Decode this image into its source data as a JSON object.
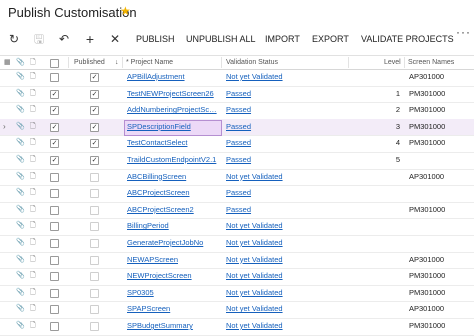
{
  "title": "Publish Customisation",
  "icons": {
    "favorite": "★",
    "refresh": "↻",
    "save": "🖫",
    "undo": "↶",
    "add": "+",
    "delete": "✕",
    "more": "⋮",
    "attachment": "📎",
    "notes": "🗋",
    "row_indicator": "›",
    "sort_arrow": "↓"
  },
  "toolbar": {
    "publish": "PUBLISH",
    "unpublish_all": "UNPUBLISH ALL",
    "import": "IMPORT",
    "export": "EXPORT",
    "validate_projects": "VALIDATE PROJECTS",
    "more": "···"
  },
  "columns": {
    "published": "Published",
    "project_name": "* Project Name",
    "validation_status": "Validation Status",
    "level": "Level",
    "screen_names": "Screen Names"
  },
  "rows": [
    {
      "checked": false,
      "published": true,
      "project": "APBillAdjustment",
      "status": "Not yet Validated",
      "level": "",
      "screens": "AP301000"
    },
    {
      "checked": true,
      "published": true,
      "project": "TestNEWProjectScreen26",
      "status": "Passed",
      "level": "1",
      "screens": "PM301000"
    },
    {
      "checked": true,
      "published": true,
      "project": "AddNumberingProjectSc…",
      "status": "Passed",
      "level": "2",
      "screens": "PM301000"
    },
    {
      "checked": true,
      "published": true,
      "project": "SPDescriptionField",
      "status": "Passed",
      "level": "3",
      "screens": "PM301000",
      "selected": true
    },
    {
      "checked": true,
      "published": true,
      "project": "TestContactSelect",
      "status": "Passed",
      "level": "4",
      "screens": "PM301000"
    },
    {
      "checked": true,
      "published": true,
      "project": "TraildCustomEndpointV2.1",
      "status": "Passed",
      "level": "5",
      "screens": ""
    },
    {
      "checked": false,
      "published": false,
      "project": "ABCBillingScreen",
      "status": "Not yet Validated",
      "level": "",
      "screens": "AP301000"
    },
    {
      "checked": false,
      "published": false,
      "project": "ABCProjectScreen",
      "status": "Passed",
      "level": "",
      "screens": ""
    },
    {
      "checked": false,
      "published": false,
      "project": "ABCProjectScreen2",
      "status": "Passed",
      "level": "",
      "screens": "PM301000"
    },
    {
      "checked": false,
      "published": false,
      "project": "BillingPeriod",
      "status": "Not yet Validated",
      "level": "",
      "screens": ""
    },
    {
      "checked": false,
      "published": false,
      "project": "GenerateProjectJobNo",
      "status": "Not yet Validated",
      "level": "",
      "screens": ""
    },
    {
      "checked": false,
      "published": false,
      "project": "NEWAPScreen",
      "status": "Not yet Validated",
      "level": "",
      "screens": "AP301000"
    },
    {
      "checked": false,
      "published": false,
      "project": "NEWProjectScreen",
      "status": "Not yet Validated",
      "level": "",
      "screens": "PM301000"
    },
    {
      "checked": false,
      "published": false,
      "project": "SP0305",
      "status": "Not yet Validated",
      "level": "",
      "screens": "PM301000"
    },
    {
      "checked": false,
      "published": false,
      "project": "SPAPScreen",
      "status": "Not yet Validated",
      "level": "",
      "screens": "AP301000"
    },
    {
      "checked": false,
      "published": false,
      "project": "SPBudgetSummary",
      "status": "Not yet Validated",
      "level": "",
      "screens": "PM301000"
    }
  ],
  "colors": {
    "link": "#1560bd",
    "selected_row": "#f3ecf8",
    "selected_cell": "#ecd9f7",
    "star": "#f3b400"
  }
}
